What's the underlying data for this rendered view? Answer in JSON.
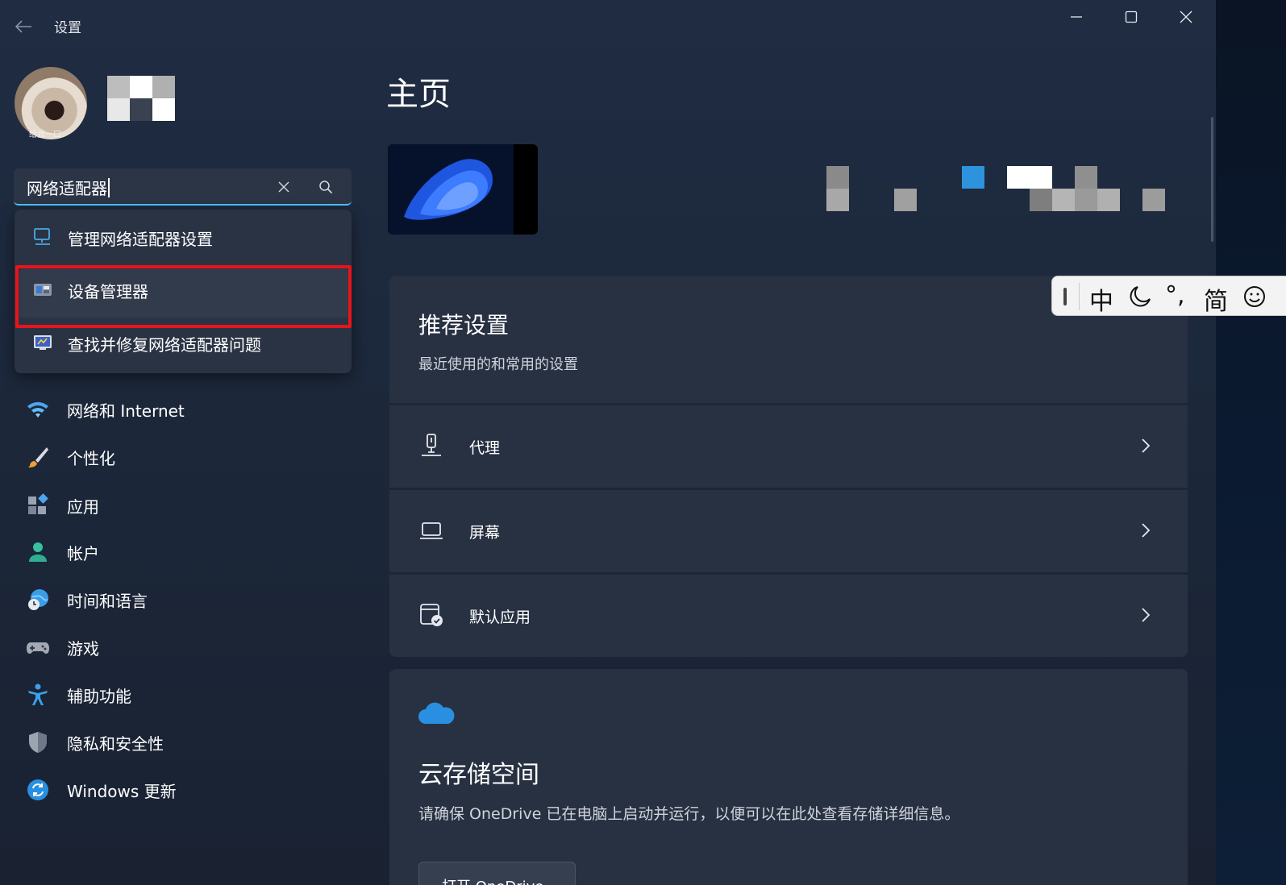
{
  "window": {
    "title": "设置"
  },
  "profile": {
    "avatar_caption": "给我一口"
  },
  "search": {
    "value": "网络适配器"
  },
  "suggestions": [
    {
      "label": "管理网络适配器设置",
      "icon": "network-adapter-icon"
    },
    {
      "label": "设备管理器",
      "icon": "device-manager-icon"
    },
    {
      "label": "查找并修复网络适配器问题",
      "icon": "troubleshoot-icon"
    }
  ],
  "nav": [
    {
      "label": "网络和 Internet",
      "icon": "wifi-icon"
    },
    {
      "label": "个性化",
      "icon": "brush-icon"
    },
    {
      "label": "应用",
      "icon": "apps-icon"
    },
    {
      "label": "帐户",
      "icon": "account-icon"
    },
    {
      "label": "时间和语言",
      "icon": "globe-clock-icon"
    },
    {
      "label": "游戏",
      "icon": "gamepad-icon"
    },
    {
      "label": "辅助功能",
      "icon": "accessibility-icon"
    },
    {
      "label": "隐私和安全性",
      "icon": "shield-icon"
    },
    {
      "label": "Windows 更新",
      "icon": "update-icon"
    }
  ],
  "main": {
    "title": "主页",
    "recommended": {
      "title": "推荐设置",
      "subtitle": "最近使用的和常用的设置",
      "items": [
        {
          "label": "代理",
          "icon": "proxy-icon"
        },
        {
          "label": "屏幕",
          "icon": "laptop-icon"
        },
        {
          "label": "默认应用",
          "icon": "default-apps-icon"
        }
      ]
    },
    "cloud": {
      "title": "云存储空间",
      "description": "请确保 OneDrive 已在电脑上启动并运行，以便可以在此处查看存储详细信息。",
      "button_label": "打开 OneDrive"
    }
  },
  "ime": {
    "mode": "中",
    "punct": "°,",
    "script": "简"
  },
  "colors": {
    "accent": "#4cc2ff",
    "highlight_border": "#e8141c",
    "card_bg": "#273142",
    "window_bg": "#1f2c42"
  }
}
